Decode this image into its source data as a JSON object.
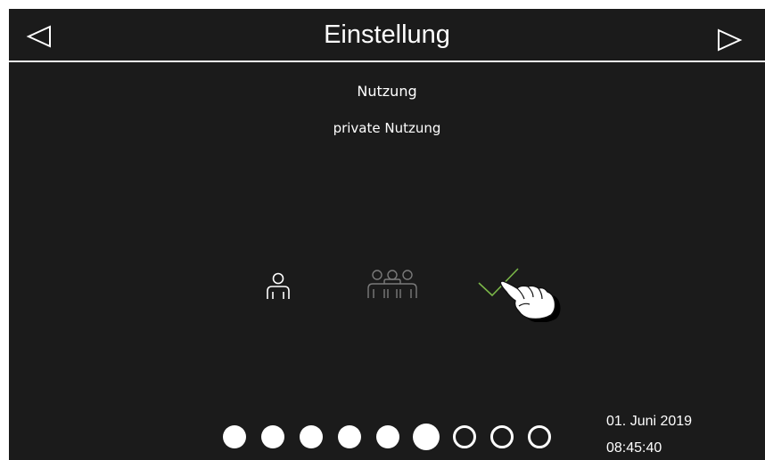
{
  "header": {
    "title": "Einstellung",
    "nav_prev_icon": "triangle-left-icon",
    "nav_next_icon": "triangle-right-icon"
  },
  "setting": {
    "name": "Nutzung",
    "value": "private Nutzung"
  },
  "options": [
    {
      "icon": "single-person-icon",
      "state": "selected"
    },
    {
      "icon": "group-of-people-icon",
      "state": "dimmed"
    },
    {
      "icon": "checkmark-icon",
      "state": "confirm"
    }
  ],
  "pager": {
    "total": 9,
    "current": 6,
    "filled": 6
  },
  "status": {
    "date": "01. Juni 2019",
    "time": "08:45:40"
  },
  "colors": {
    "background": "#1b1b1b",
    "foreground": "#ffffff",
    "dimmed_icon": "#7a7a7a",
    "confirm_green": "#7ab648"
  }
}
